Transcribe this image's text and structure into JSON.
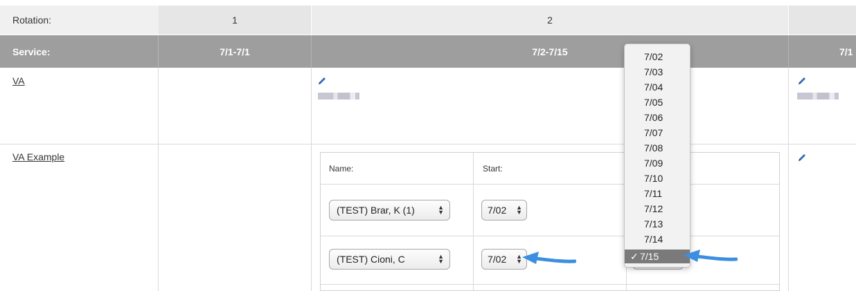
{
  "header": {
    "rotation_label": "Rotation:",
    "rotation_1": "1",
    "rotation_2": "2",
    "service_label": "Service:",
    "service_1": "7/1-7/1",
    "service_2": "7/2-7/15",
    "service_3": "7/1"
  },
  "rows": {
    "va": "VA",
    "va_example": "VA Example"
  },
  "assignments": {
    "name_header": "Name:",
    "start_header": "Start:",
    "row1": {
      "name": "(TEST) Brar, K (1)",
      "start": "7/02"
    },
    "row2": {
      "name": "(TEST) Cioni, C",
      "start": "7/02"
    }
  },
  "dropdown": {
    "options": [
      "7/02",
      "7/03",
      "7/04",
      "7/05",
      "7/06",
      "7/07",
      "7/08",
      "7/09",
      "7/10",
      "7/11",
      "7/12",
      "7/13",
      "7/14",
      "7/15"
    ],
    "selected": "7/15",
    "check": "✓"
  },
  "colors": {
    "service_bar": "#9e9e9e",
    "rotation_bar": "#e6e6e6",
    "arrow": "#3c8fe0",
    "pencil": "#2f6db5"
  },
  "icons": {
    "edit": "pencil-icon",
    "select_arrows": "updown-chevron-icon"
  }
}
